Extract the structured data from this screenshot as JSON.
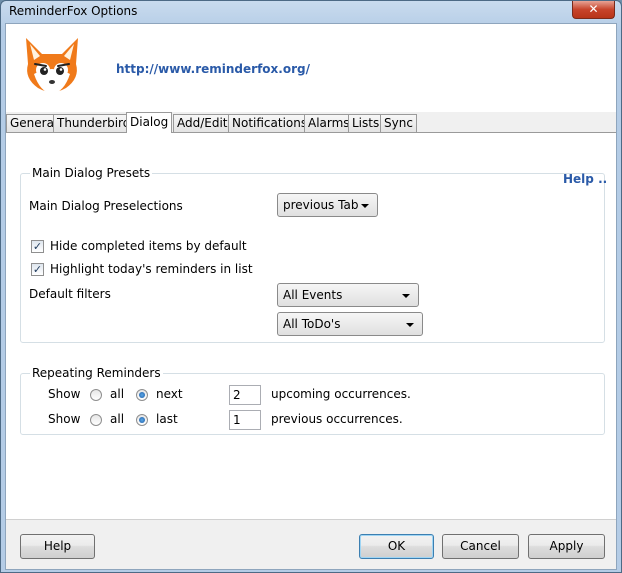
{
  "window": {
    "title": "ReminderFox Options",
    "close_glyph": "✕"
  },
  "header": {
    "url": "http://www.reminderfox.org/",
    "logo_icon": "fox-logo-icon"
  },
  "tabs": [
    {
      "label": "General"
    },
    {
      "label": "Thunderbird"
    },
    {
      "label": "Dialog",
      "selected": true
    },
    {
      "label": "Add/Edit"
    },
    {
      "label": "Notifications"
    },
    {
      "label": "Alarms"
    },
    {
      "label": "Lists"
    },
    {
      "label": "Sync"
    }
  ],
  "main_presets": {
    "title": "Main Dialog Presets",
    "help": "Help ..",
    "preselections_label": "Main Dialog Preselections",
    "preselections_value": "previous Tab",
    "hide_completed": {
      "label": "Hide completed items by default",
      "checked": true
    },
    "highlight_today": {
      "label": "Highlight today's reminders in list",
      "checked": true
    },
    "default_filters_label": "Default filters",
    "filter_events": "All Events",
    "filter_todos": "All ToDo's"
  },
  "repeating": {
    "title": "Repeating Reminders",
    "row1": {
      "show": "Show",
      "all": "all",
      "option": "next",
      "value": "2",
      "suffix": "upcoming occurrences."
    },
    "row2": {
      "show": "Show",
      "all": "all",
      "option": "last",
      "value": "1",
      "suffix": "previous occurrences."
    }
  },
  "buttons": {
    "help": "Help",
    "ok": "OK",
    "cancel": "Cancel",
    "apply": "Apply"
  },
  "colors": {
    "link": "#2a5aa8",
    "fox_orange": "#f07a1a",
    "close_red": "#c7442b"
  }
}
